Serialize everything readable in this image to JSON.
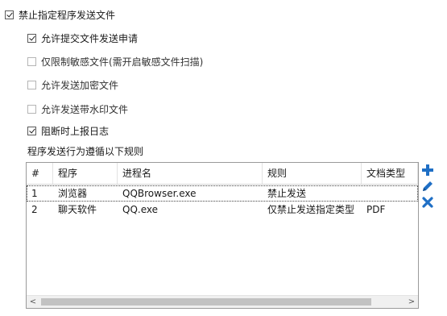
{
  "options": [
    {
      "label": "禁止指定程序发送文件",
      "checked": true
    },
    {
      "label": "允许提交文件发送申请",
      "checked": true
    },
    {
      "label": "仅限制敏感文件(需开启敏感文件扫描)",
      "checked": false
    },
    {
      "label": "允许发送加密文件",
      "checked": false
    },
    {
      "label": "允许发送带水印文件",
      "checked": false
    },
    {
      "label": "阻断时上报日志",
      "checked": true
    }
  ],
  "rules_caption": "程序发送行为遵循以下规则",
  "table": {
    "headers": [
      "#",
      "程序",
      "进程名",
      "规则",
      "文档类型"
    ],
    "rows": [
      [
        "1",
        "浏览器",
        "QQBrowser.exe",
        "禁止发送",
        ""
      ],
      [
        "2",
        "聊天软件",
        "QQ.exe",
        "仅禁止发送指定类型",
        "PDF"
      ]
    ]
  },
  "scrollbar": {
    "left_glyph": "<",
    "right_glyph": ">"
  },
  "side_toolbar": {
    "icons": [
      "plus-icon",
      "pencil-icon",
      "delete-x-icon"
    ],
    "color": "#1f6fc5"
  }
}
